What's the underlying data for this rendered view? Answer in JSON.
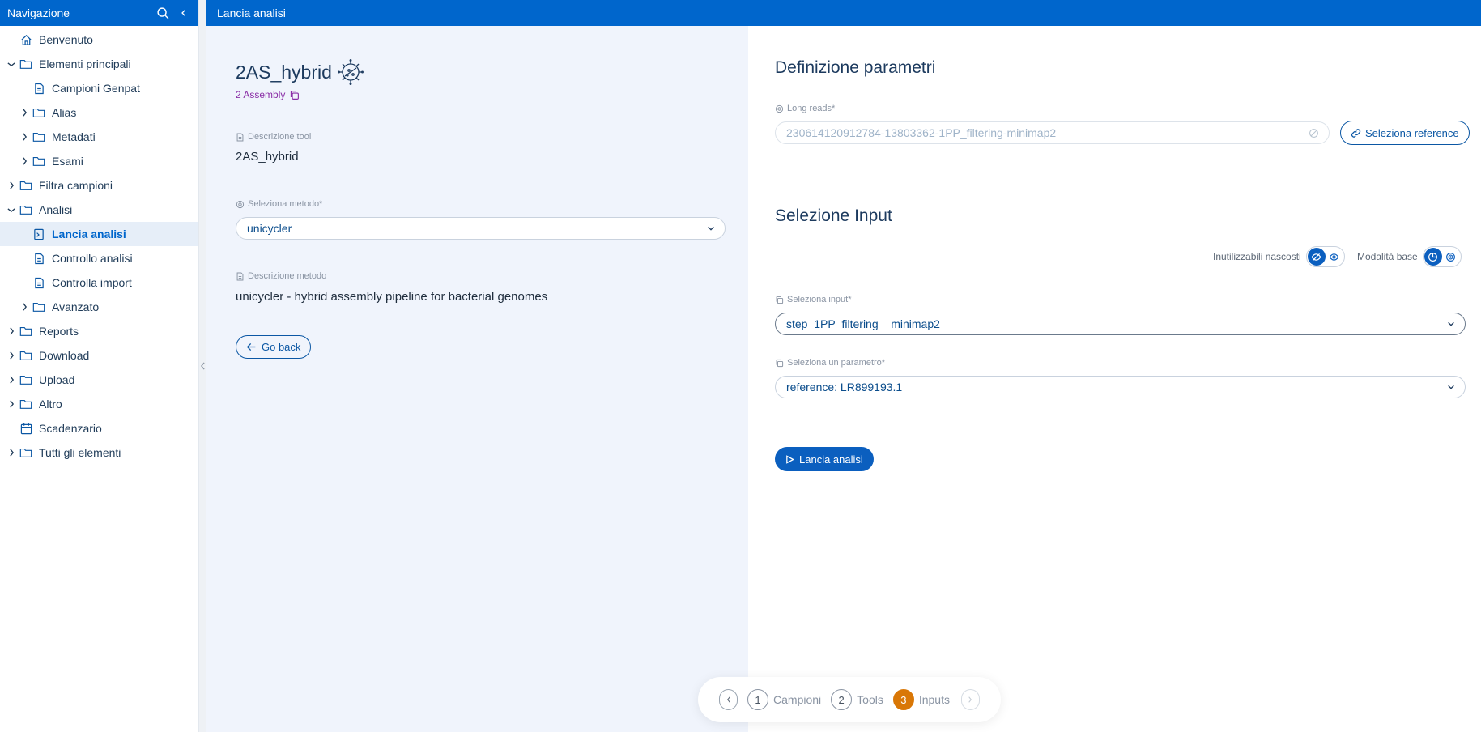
{
  "sidebar": {
    "title": "Navigazione",
    "items": [
      {
        "label": "Benvenuto",
        "icon": "home-icon",
        "indent": 0,
        "chevron": "none"
      },
      {
        "label": "Elementi principali",
        "icon": "folder-icon",
        "indent": 0,
        "chevron": "down"
      },
      {
        "label": "Campioni Genpat",
        "icon": "document-icon",
        "indent": 1,
        "chevron": "none"
      },
      {
        "label": "Alias",
        "icon": "folder-icon",
        "indent": 1,
        "chevron": "right"
      },
      {
        "label": "Metadati",
        "icon": "folder-icon",
        "indent": 1,
        "chevron": "right"
      },
      {
        "label": "Esami",
        "icon": "folder-icon",
        "indent": 1,
        "chevron": "right"
      },
      {
        "label": "Filtra campioni",
        "icon": "folder-icon",
        "indent": 0,
        "chevron": "right"
      },
      {
        "label": "Analisi",
        "icon": "folder-icon",
        "indent": 0,
        "chevron": "down"
      },
      {
        "label": "Lancia analisi",
        "icon": "terminal-icon",
        "indent": 1,
        "chevron": "none",
        "active": true
      },
      {
        "label": "Controllo analisi",
        "icon": "document-icon",
        "indent": 1,
        "chevron": "none"
      },
      {
        "label": "Controlla import",
        "icon": "document-icon",
        "indent": 1,
        "chevron": "none"
      },
      {
        "label": "Avanzato",
        "icon": "folder-icon",
        "indent": 1,
        "chevron": "right"
      },
      {
        "label": "Reports",
        "icon": "folder-icon",
        "indent": 0,
        "chevron": "right"
      },
      {
        "label": "Download",
        "icon": "folder-icon",
        "indent": 0,
        "chevron": "right"
      },
      {
        "label": "Upload",
        "icon": "folder-icon",
        "indent": 0,
        "chevron": "right"
      },
      {
        "label": "Altro",
        "icon": "folder-icon",
        "indent": 0,
        "chevron": "right"
      },
      {
        "label": "Scadenzario",
        "icon": "calendar-icon",
        "indent": 0,
        "chevron": "none"
      },
      {
        "label": "Tutti gli elementi",
        "icon": "folder-icon",
        "indent": 0,
        "chevron": "right"
      }
    ]
  },
  "topbar": {
    "title": "Lancia analisi"
  },
  "tool": {
    "name": "2AS_hybrid",
    "icon": "bacteria-icon",
    "subtitle": "2 Assembly",
    "description_label": "Descrizione tool",
    "description": "2AS_hybrid",
    "method_label": "Seleziona metodo*",
    "method_value": "unicycler",
    "method_desc_label": "Descrizione metodo",
    "method_desc": "unicycler - hybrid assembly pipeline for bacterial genomes",
    "back_label": "Go back"
  },
  "params": {
    "title": "Definizione parametri",
    "long_reads_label": "Long reads*",
    "long_reads_value": "230614120912784-13803362-1PP_filtering-minimap2",
    "select_reference_label": "Seleziona reference"
  },
  "inputs": {
    "title": "Selezione Input",
    "hidden_toggle_label": "Inutilizzabili nascosti",
    "mode_toggle_label": "Modalità base",
    "input_label": "Seleziona input*",
    "input_value": "step_1PP_filtering__minimap2",
    "param_label": "Seleziona un parametro*",
    "param_value": "reference: LR899193.1",
    "launch_label": "Lancia analisi"
  },
  "stepper": {
    "steps": [
      {
        "num": "1",
        "label": "Campioni",
        "current": false
      },
      {
        "num": "2",
        "label": "Tools",
        "current": false
      },
      {
        "num": "3",
        "label": "Inputs",
        "current": true
      }
    ]
  },
  "colors": {
    "primary": "#0066cc",
    "accent_orange": "#d97706",
    "subtitle_purple": "#8a2ea6"
  }
}
